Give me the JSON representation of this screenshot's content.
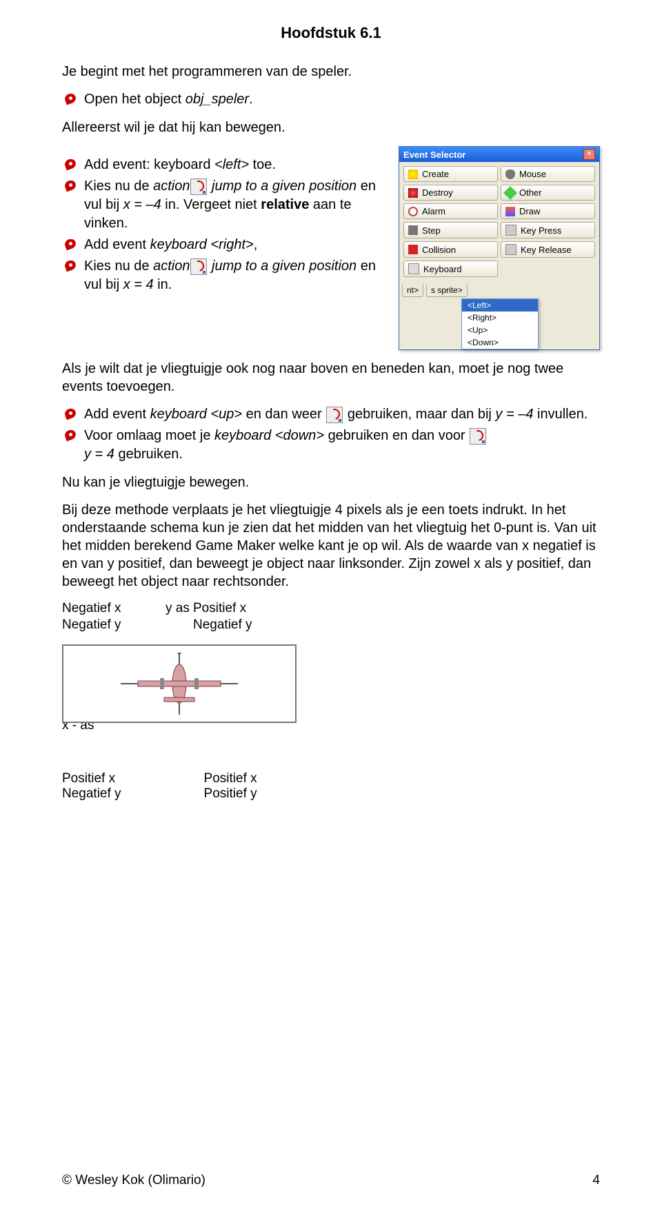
{
  "title": "Hoofdstuk 6.1",
  "p1": "Je begint met het programmeren van de speler.",
  "b1": {
    "pre": "Open het object ",
    "obj": "obj_speler",
    "post": "."
  },
  "p2": "Allereerst wil je dat hij kan bewegen.",
  "b2": {
    "pre": "Add event: keyboard ",
    "key": "<left>",
    "post": " toe."
  },
  "b3": {
    "t1": "Kies nu de ",
    "t2": "action",
    "t3": " jump to a given position",
    "t4": " en vul bij ",
    "t5": "x = –4",
    "t6": " in. Vergeet niet ",
    "t7": "relative",
    "t8": " aan te vinken."
  },
  "b4": {
    "pre": "Add event ",
    "mid": "keyboard ",
    "key": "<right>",
    "post": ","
  },
  "b5": {
    "t1": "Kies nu de ",
    "t2": "action",
    "t3": " jump to a given position",
    "t4": " en vul bij ",
    "t5": "x = 4 ",
    "t6": "in."
  },
  "p3": "Als je wilt dat je vliegtuigje ook nog naar boven en beneden kan, moet je nog twee events toevoegen.",
  "b6": {
    "t1": "Add event ",
    "t2": "keyboard <up>",
    "t3": " en dan weer ",
    "t4": " gebruiken, maar dan bij ",
    "t5": "y = –4",
    "t6": " invullen."
  },
  "b7": {
    "t1": "Voor omlaag moet je ",
    "t2": "keyboard <down> ",
    "t3": "gebruiken en dan voor ",
    "t4": "y = 4 ",
    "t5": "gebruiken."
  },
  "p4": "Nu kan je vliegtuigje bewegen.",
  "p5": "Bij deze methode verplaats je het vliegtuigje 4 pixels als je een toets indrukt. In het onderstaande schema kun je zien dat het midden van het vliegtuig het 0-punt is. Van uit het midden berekend Game Maker welke kant je op wil. Als de waarde van x negatief is en van y positief, dan beweegt je object naar linksonder. Zijn zowel x als y positief, dan beweegt het object naar rechtsonder.",
  "es": {
    "title": "Event Selector",
    "buttons": [
      "Create",
      "Mouse",
      "Destroy",
      "Other",
      "Alarm",
      "Draw",
      "Step",
      "Key Press",
      "Collision",
      "Key Release",
      "Keyboard"
    ],
    "submenu": [
      "<Left>",
      "<Right>",
      "<Up>",
      "<Down>"
    ],
    "frag": [
      "nt>",
      "s sprite>"
    ]
  },
  "quad": {
    "tl1": "Negatief x",
    "tl2": "Negatief y",
    "yas": "y   as",
    "tr1": "Positief x",
    "tr2": "Negatief y",
    "xas": "x - as",
    "bl1": "Positief x",
    "bl2": "Negatief y",
    "br1": "Positief x",
    "br2": "Positief y"
  },
  "footer": {
    "author": "© Wesley Kok (Olimario)",
    "page": "4"
  }
}
